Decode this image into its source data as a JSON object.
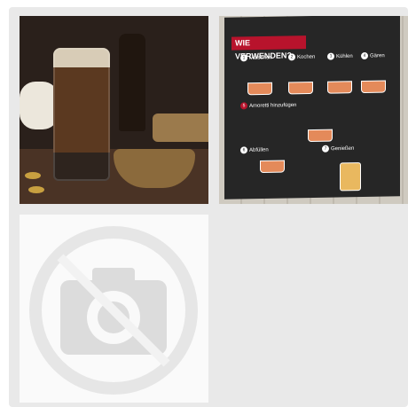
{
  "gallery": {
    "tiles": [
      {
        "kind": "photo",
        "icon": "beer-photo"
      },
      {
        "kind": "infographic",
        "title": "WIE VERWENDEN?",
        "steps": [
          "1",
          "Maischen",
          "2",
          "Kochen",
          "3",
          "Kühlen",
          "4",
          "Gären",
          "5",
          "Amoretti hinzufügen",
          "6",
          "Abfüllen",
          "7",
          "Genießen"
        ]
      },
      {
        "kind": "placeholder",
        "icon": "no-image-camera-icon"
      }
    ]
  },
  "colors": {
    "panel": "#e9e9e9",
    "accent": "#b8132c",
    "board": "#262626"
  }
}
